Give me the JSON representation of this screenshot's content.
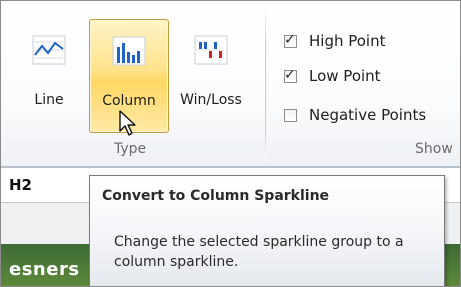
{
  "ribbon": {
    "type_group": {
      "label": "Type",
      "buttons": [
        {
          "label": "Line",
          "icon": "line-sparkline-icon",
          "selected": false
        },
        {
          "label": "Column",
          "icon": "column-sparkline-icon",
          "selected": true
        },
        {
          "label": "Win/Loss",
          "icon": "winloss-sparkline-icon",
          "selected": false
        }
      ]
    },
    "show_group": {
      "label": "Show",
      "checkboxes": [
        {
          "label": "High Point",
          "checked": true
        },
        {
          "label": "Low Point",
          "checked": true
        },
        {
          "label": "Negative Points",
          "checked": false
        }
      ]
    }
  },
  "name_box": {
    "value": "H2"
  },
  "sheet": {
    "partial_text": "esners",
    "partial_text_right": "…"
  },
  "tooltip": {
    "title": "Convert to Column Sparkline",
    "body": "Change the selected sparkline group to a column sparkline."
  },
  "colors": {
    "selected_button_fill": "#ffe28a",
    "selected_button_border": "#c29b3a",
    "sparkline_blue": "#1f63c6",
    "sparkline_red": "#d12020"
  }
}
